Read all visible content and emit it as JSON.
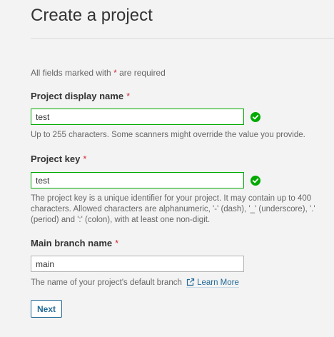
{
  "page": {
    "title": "Create a project"
  },
  "required_note": {
    "prefix": "All fields marked with",
    "asterisk": "*",
    "suffix": "are required"
  },
  "form": {
    "display_name": {
      "label": "Project display name",
      "required_mark": "*",
      "value": "test",
      "valid": true,
      "help": "Up to 255 characters. Some scanners might override the value you provide."
    },
    "project_key": {
      "label": "Project key",
      "required_mark": "*",
      "value": "test",
      "valid": true,
      "help": "The project key is a unique identifier for your project. It may contain up to 400 characters. Allowed characters are alphanumeric, '-' (dash), '_' (underscore), '.' (period) and ':' (colon), with at least one non-digit."
    },
    "main_branch": {
      "label": "Main branch name",
      "required_mark": "*",
      "value": "main",
      "help": "The name of your project's default branch",
      "learn_more_label": "Learn More",
      "learn_more_icon": "external-link-icon"
    },
    "next_label": "Next"
  },
  "colors": {
    "valid": "#00aa00",
    "required": "#d02f3a",
    "link": "#236a97",
    "background": "#f3f3f3"
  },
  "icons": {
    "valid": "check-circle-icon"
  }
}
